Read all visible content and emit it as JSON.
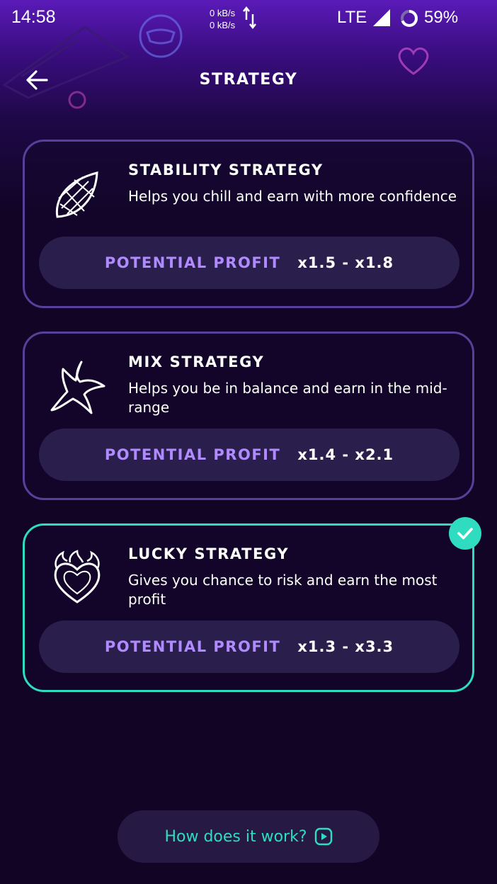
{
  "status_bar": {
    "time": "14:58",
    "net_up": "0 kB/s",
    "net_down": "0 kB/s",
    "network": "LTE",
    "battery": "59%"
  },
  "header": {
    "title": "STRATEGY",
    "back_icon": "arrow-left-icon"
  },
  "strategies": [
    {
      "title": "STABILITY STRATEGY",
      "description": "Helps you chill and earn with more confidence",
      "profit_label": "POTENTIAL PROFIT",
      "profit_value": "x1.5 - x1.8",
      "icon": "leaf-icon",
      "selected": false
    },
    {
      "title": "MIX STRATEGY",
      "description": "Helps you be in balance and earn in the mid-range",
      "profit_label": "POTENTIAL PROFIT",
      "profit_value": "x1.4 - x2.1",
      "icon": "star-icon",
      "selected": false
    },
    {
      "title": "LUCKY STRATEGY",
      "description": "Gives you chance to risk and earn the most profit",
      "profit_label": "POTENTIAL PROFIT",
      "profit_value": "x1.3 - x3.3",
      "icon": "flaming-heart-icon",
      "selected": true
    }
  ],
  "footer": {
    "how_label": "How does it work?",
    "how_icon": "play-icon"
  },
  "colors": {
    "background": "#110425",
    "accent_teal": "#2fdcc0",
    "accent_purple": "#b08aff",
    "card_border": "#55409a",
    "pill_bg": "#2a1f4c"
  }
}
